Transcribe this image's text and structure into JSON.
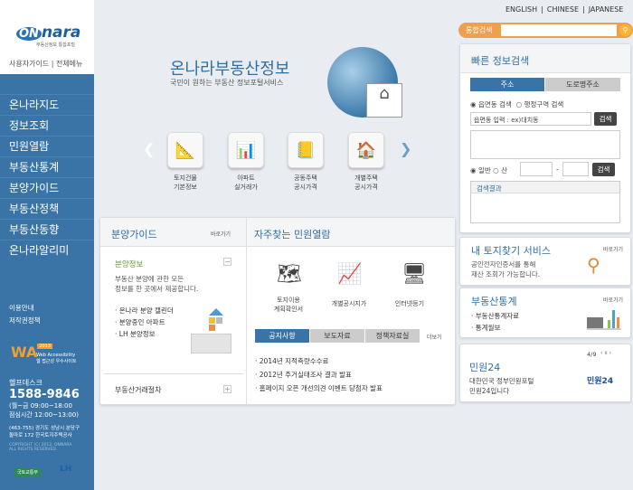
{
  "logo": {
    "text": "nara",
    "badge": "ON",
    "sub": "부동산정보 통합포털"
  },
  "top_links": [
    "사용자가이드",
    "전체메뉴"
  ],
  "menu": [
    "온나라지도",
    "정보조회",
    "민원열람",
    "부동산통계",
    "분양가이드",
    "부동산정책",
    "부동산동향",
    "온나라알리미"
  ],
  "side_links": [
    "이용안내",
    "저작권정책"
  ],
  "wa_badge": {
    "text": "WA",
    "year": "2013",
    "caption1": "Web Accessibility",
    "caption2": "웹 접근성 우수사이트"
  },
  "helpdesk": {
    "label": "헬프데스크",
    "phone": "1588-9846",
    "hours": "(월~금 09:00~18:00",
    "lunch": "점심시간 12:00~13:00)",
    "address1": "(463-755) 경기도 성남시 분당구",
    "address2": "돌마로 172 한국토지주택공사",
    "copyright1": "COPYRIGHT (C) 2012, ONNARA.",
    "copyright2": "ALL RIGHTS RESERVED."
  },
  "footer_logos": [
    "국토교통부",
    "LH"
  ],
  "languages": [
    "ENGLISH",
    "CHINESE",
    "JAPANESE"
  ],
  "search": {
    "label": "통합검색",
    "value": ""
  },
  "hero": {
    "title": "온나라부동산정보",
    "subtitle": "국민이 원하는 부동산 정보포털서비스"
  },
  "quick_icons": [
    {
      "icon": "ruler-icon",
      "l1": "토지건물",
      "l2": "기본정보"
    },
    {
      "icon": "bar-chart-icon",
      "l1": "아파트",
      "l2": "실거래가"
    },
    {
      "icon": "notebook-icon",
      "l1": "공동주택",
      "l2": "공시가격"
    },
    {
      "icon": "house-icon",
      "l1": "개별주택",
      "l2": "공시가격"
    }
  ],
  "quick_search": {
    "title": "빠른 정보검색",
    "tabs": [
      "주소",
      "도로명주소"
    ],
    "radio1": [
      "읍면동 검색",
      "행정구역 검색"
    ],
    "input_placeholder": "읍면동 입력 : ex)대치동",
    "search_btn": "검색",
    "radio2": [
      "일반",
      "산"
    ],
    "dash": "-",
    "result_label": "검색결과"
  },
  "guide": {
    "title": "분양가이드",
    "more": "바로가기",
    "section": "분양정보",
    "desc1": "부동산 분양에 관한 모든",
    "desc2": "정보를 한 곳에서 제공합니다.",
    "items": [
      "온나라 분양 캘린더",
      "분양중인 아파트",
      "LH 분양정보"
    ],
    "section2": "부동산거래절차"
  },
  "civil": {
    "title": "자주찾는 민원열람",
    "icons": [
      {
        "l1": "토지이용",
        "l2": "계획확인서"
      },
      {
        "l1": "개별공시지가",
        "l2": ""
      },
      {
        "l1": "인터넷등기",
        "l2": ""
      }
    ],
    "tabs": [
      "공지사항",
      "보도자료",
      "정책자료실"
    ],
    "more": "더보기",
    "notices": [
      "2014년 지적측량수수료",
      "2012년 주거실태조사 결과 발표",
      "홈페이지 오픈 개선의견 이벤트 당첨자 발표"
    ]
  },
  "land": {
    "title": "내 토지찾기 서비스",
    "more": "바로가기",
    "desc1": "공인전자인증서를 통해",
    "desc2": "재산 조회가 가능합니다."
  },
  "stats": {
    "title": "부동산통계",
    "more": "바로가기",
    "items": [
      "부동산통계자료",
      "통계월보"
    ]
  },
  "banner": {
    "page": "4/9",
    "title": "민원24",
    "desc1": "대한민국 정부민원포털",
    "desc2": "민원24입니다",
    "logo": "민원24"
  },
  "colors": {
    "sidebar": "#3a74a6",
    "accent": "#2f6fa3",
    "search": "#f0a04c"
  }
}
